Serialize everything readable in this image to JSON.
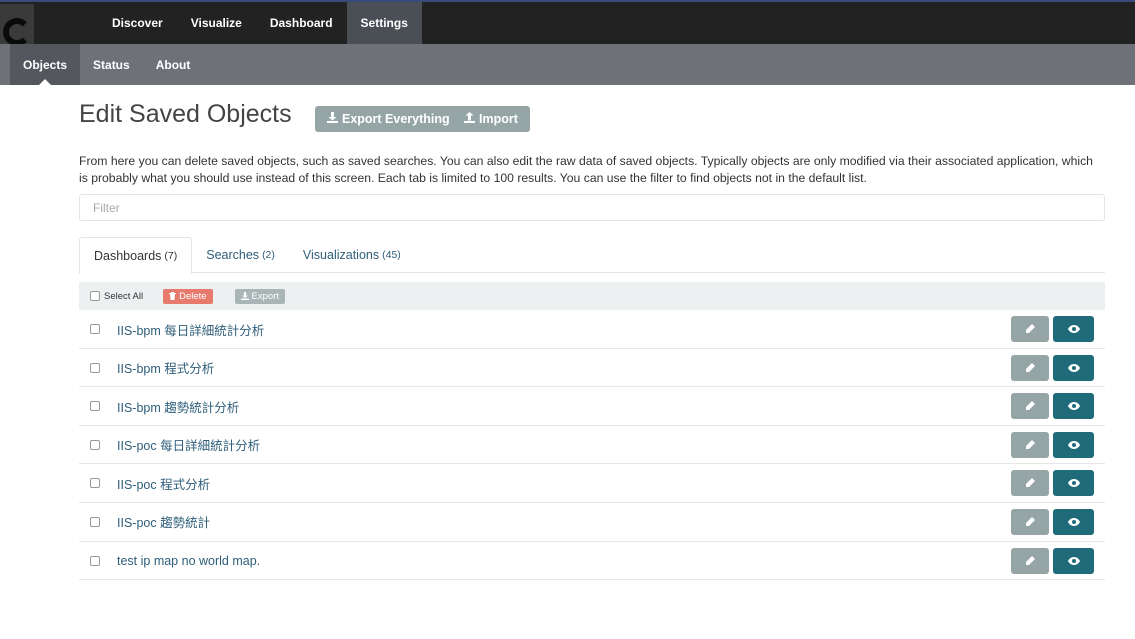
{
  "topnav": {
    "items": [
      {
        "label": "Discover",
        "active": false
      },
      {
        "label": "Visualize",
        "active": false
      },
      {
        "label": "Dashboard",
        "active": false
      },
      {
        "label": "Settings",
        "active": true
      }
    ]
  },
  "subnav": {
    "items": [
      {
        "label": "Objects",
        "active": true
      },
      {
        "label": "Status",
        "active": false
      },
      {
        "label": "About",
        "active": false
      }
    ]
  },
  "page": {
    "title": "Edit Saved Objects",
    "export_everything_label": "Export Everything",
    "import_label": "Import",
    "description": "From here you can delete saved objects, such as saved searches. You can also edit the raw data of saved objects. Typically objects are only modified via their associated application, which is probably what you should use instead of this screen. Each tab is limited to 100 results. You can use the filter to find objects not in the default list.",
    "filter_placeholder": "Filter"
  },
  "tabs": [
    {
      "label": "Dashboards",
      "count": "(7)",
      "active": true
    },
    {
      "label": "Searches",
      "count": "(2)",
      "active": false
    },
    {
      "label": "Visualizations",
      "count": "(45)",
      "active": false
    }
  ],
  "toolbar": {
    "select_all_label": "Select All",
    "delete_label": "Delete",
    "export_label": "Export"
  },
  "objects": [
    {
      "title": "IIS-bpm 每日詳細統計分析"
    },
    {
      "title": "IIS-bpm 程式分析"
    },
    {
      "title": "IIS-bpm 趨勢統計分析"
    },
    {
      "title": "IIS-poc 每日詳細統計分析"
    },
    {
      "title": "IIS-poc 程式分析"
    },
    {
      "title": "IIS-poc 趨勢統計"
    },
    {
      "title": "test ip map no world map."
    }
  ],
  "colors": {
    "topbar": "#222222",
    "subbar": "#6e7178",
    "view_button": "#1f6b7a",
    "edit_button": "#95a5a6",
    "delete_button": "#e77a6c",
    "link": "#2f5e7a"
  },
  "icons": {
    "export": "download-icon",
    "import": "upload-icon",
    "delete": "trash-icon",
    "edit": "pencil-icon",
    "view": "eye-icon"
  }
}
